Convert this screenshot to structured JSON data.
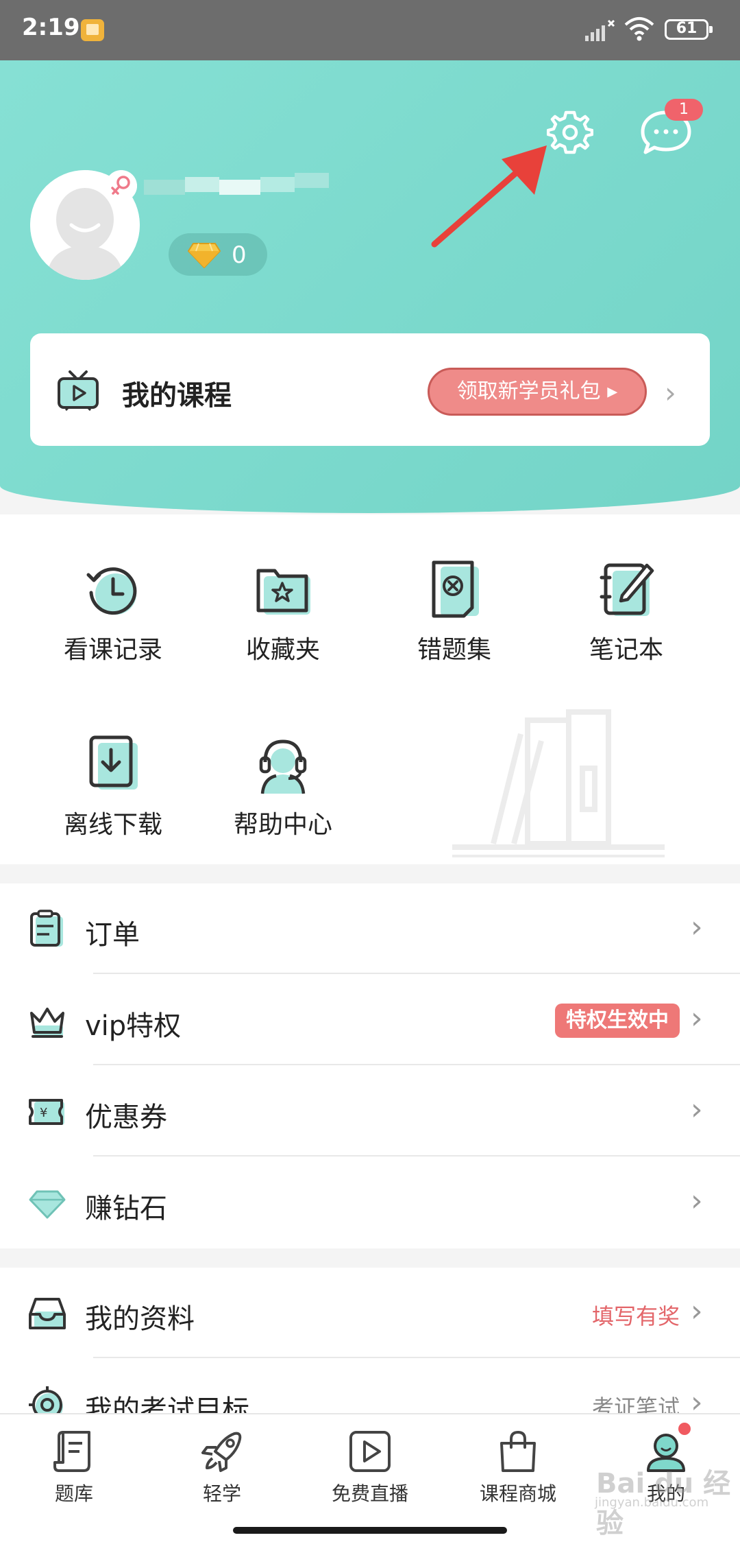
{
  "status_bar": {
    "time": "2:19",
    "battery": "61"
  },
  "header": {
    "message_badge": "1",
    "diamond_count": "0"
  },
  "course_card": {
    "title": "我的课程",
    "gift_button": "领取新学员礼包 ▸"
  },
  "grid": [
    {
      "label": "看课记录",
      "icon": "history-icon"
    },
    {
      "label": "收藏夹",
      "icon": "favorites-folder-icon"
    },
    {
      "label": "错题集",
      "icon": "wrong-questions-icon"
    },
    {
      "label": "笔记本",
      "icon": "notebook-icon"
    },
    {
      "label": "离线下载",
      "icon": "download-icon"
    },
    {
      "label": "帮助中心",
      "icon": "headset-icon"
    }
  ],
  "list1": [
    {
      "label": "订单",
      "icon": "clipboard-icon"
    },
    {
      "label": "vip特权",
      "icon": "crown-icon",
      "tag": "特权生效中"
    },
    {
      "label": "优惠券",
      "icon": "coupon-icon"
    },
    {
      "label": "赚钻石",
      "icon": "diamond-icon"
    }
  ],
  "list2": [
    {
      "label": "我的资料",
      "icon": "inbox-icon",
      "side": "填写有奖"
    },
    {
      "label": "我的考试目标",
      "icon": "target-icon",
      "side": "考证笔试"
    }
  ],
  "bottom_nav": [
    {
      "label": "题库",
      "icon": "question-bank-icon"
    },
    {
      "label": "轻学",
      "icon": "rocket-icon"
    },
    {
      "label": "免费直播",
      "icon": "live-play-icon"
    },
    {
      "label": "课程商城",
      "icon": "shopping-bag-icon"
    },
    {
      "label": "我的",
      "icon": "profile-icon"
    }
  ],
  "watermark": {
    "main": "Bai du 经验",
    "sub": "jingyan.baidu.com"
  },
  "colors": {
    "teal": "#78d8cb",
    "accent_red": "#ee7877",
    "icon_fill": "#a8e6de"
  }
}
